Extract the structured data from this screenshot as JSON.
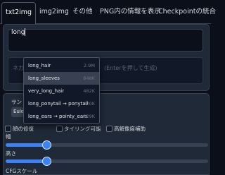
{
  "tabs": [
    {
      "label": "txt2img"
    },
    {
      "label": "img2img"
    },
    {
      "label": "その他"
    },
    {
      "label": "PNG内の情報を表示"
    },
    {
      "label": "Checkpointの統合"
    }
  ],
  "prompt": {
    "value": "long"
  },
  "negative_prompt": {
    "placeholder": "ネガ",
    "suffix": "(Enterを押して生成)"
  },
  "autocomplete": [
    {
      "tag": "long_hair",
      "count": "2.9M"
    },
    {
      "tag": "long_sleeves",
      "count": "848K"
    },
    {
      "tag": "very_long_hair",
      "count": "482K"
    },
    {
      "tag": "long_ponytail → ponytail",
      "count": "420K"
    },
    {
      "tag": "long_ears → pointy_ears",
      "count": "229K"
    }
  ],
  "settings": {
    "sampler_label": "サン",
    "sampler_value": "Eule",
    "restore_faces": "顔の修復",
    "tiling": "タイリング可能",
    "hires_fix": "高解像度補助",
    "width_label": "幅",
    "height_label": "高さ",
    "cfg_label": "CFGスケール"
  },
  "sliders": {
    "width_fraction": 0.2,
    "height_fraction": 0.2,
    "cfg_fraction": 0.25
  },
  "colors": {
    "background": "#0b0f19",
    "panel": "#1f2937",
    "accent": "#3b82f6"
  }
}
